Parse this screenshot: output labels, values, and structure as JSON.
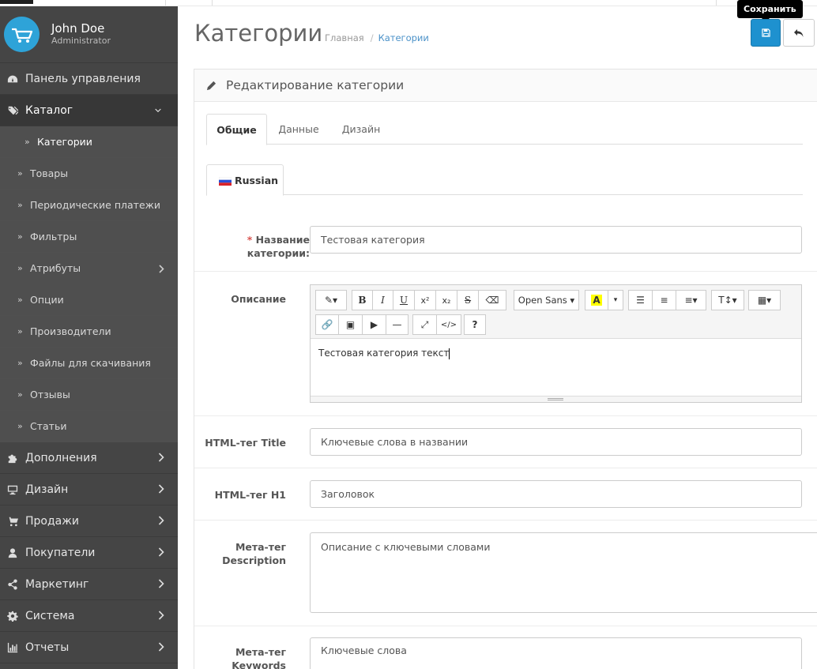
{
  "profile": {
    "name": "John Doe",
    "role": "Administrator"
  },
  "sidebar": {
    "items": [
      {
        "label": "Панель управления",
        "icon": "dashboard-icon"
      },
      {
        "label": "Каталог",
        "icon": "tags-icon"
      },
      {
        "label": "Дополнения",
        "icon": "puzzle-icon"
      },
      {
        "label": "Дизайн",
        "icon": "desktop-icon"
      },
      {
        "label": "Продажи",
        "icon": "cart-icon"
      },
      {
        "label": "Покупатели",
        "icon": "user-icon"
      },
      {
        "label": "Маркетинг",
        "icon": "share-icon"
      },
      {
        "label": "Система",
        "icon": "cog-icon"
      },
      {
        "label": "Отчеты",
        "icon": "bar-chart-icon"
      }
    ],
    "catalog_sub": [
      "Категории",
      "Товары",
      "Периодические платежи",
      "Фильтры",
      "Атрибуты",
      "Опции",
      "Производители",
      "Файлы для скачивания",
      "Отзывы",
      "Статьи"
    ]
  },
  "header": {
    "title": "Категории",
    "breadcrumb": {
      "home": "Главная",
      "separator": "/",
      "current": "Категории"
    },
    "save_tooltip": "Сохранить"
  },
  "panel": {
    "title": "Редактирование категории",
    "tabs": [
      "Общие",
      "Данные",
      "Дизайн"
    ],
    "language_tab": "Russian"
  },
  "form": {
    "required_mark": "*",
    "name_label": "Название категории:",
    "name_value": "Тестовая категория",
    "description_label": "Описание",
    "description_value": "Тестовая категория текст",
    "editor_font": "Open Sans",
    "title_label": "HTML-тег Title",
    "title_value": "Ключевые слова в названии",
    "h1_label": "HTML-тег H1",
    "h1_value": "Заголовок",
    "meta_desc_label": "Мета-тег Description",
    "meta_desc_value": "Описание с ключевыми словами",
    "meta_kw_label": "Мета-тег Keywords",
    "meta_kw_value": "Ключевые слова"
  },
  "colors": {
    "sidebar": "#454545",
    "accent": "#1e91cf",
    "logo": "#2ea3d8",
    "link": "#4a91c8"
  }
}
